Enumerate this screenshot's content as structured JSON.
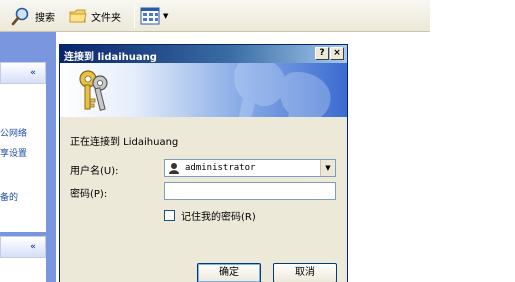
{
  "toolbar": {
    "search_label": "搜索",
    "folders_label": "文件夹"
  },
  "taskpane": {
    "section1_lines": [
      "公网络",
      "享设置",
      "备的"
    ]
  },
  "dialog": {
    "title": "连接到 lidaihuang",
    "help_label": "?",
    "close_label": "×",
    "message": "正在连接到 Lidaihuang",
    "username_label": "用户名(U):",
    "username_value": "administrator",
    "password_label": "密码(P):",
    "password_value": "",
    "remember_label": "记住我的密码(R)",
    "remember_checked": false,
    "ok_label": "确定",
    "cancel_label": "取消"
  }
}
